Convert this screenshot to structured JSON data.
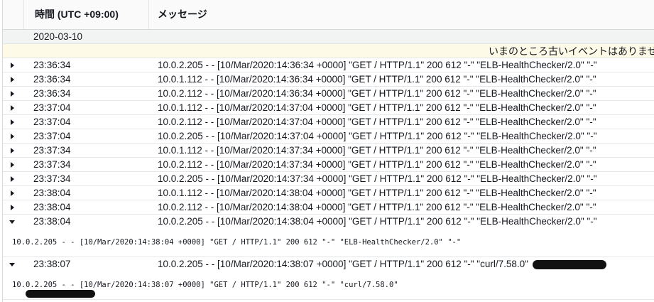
{
  "header": {
    "time_col": "時間 (UTC +09:00)",
    "message_col": "メッセージ"
  },
  "date_group": "2020-03-10",
  "notice": "いまのところ古いイベントはありませ",
  "rows": [
    {
      "time": "23:36:34",
      "message": "10.0.2.205 - - [10/Mar/2020:14:36:34 +0000] \"GET / HTTP/1.1\" 200 612 \"-\" \"ELB-HealthChecker/2.0\" \"-\"",
      "expanded": false
    },
    {
      "time": "23:36:34",
      "message": "10.0.1.112 - - [10/Mar/2020:14:36:34 +0000] \"GET / HTTP/1.1\" 200 612 \"-\" \"ELB-HealthChecker/2.0\" \"-\"",
      "expanded": false
    },
    {
      "time": "23:36:34",
      "message": "10.0.2.112 - - [10/Mar/2020:14:36:34 +0000] \"GET / HTTP/1.1\" 200 612 \"-\" \"ELB-HealthChecker/2.0\" \"-\"",
      "expanded": false
    },
    {
      "time": "23:37:04",
      "message": "10.0.1.112 - - [10/Mar/2020:14:37:04 +0000] \"GET / HTTP/1.1\" 200 612 \"-\" \"ELB-HealthChecker/2.0\" \"-\"",
      "expanded": false
    },
    {
      "time": "23:37:04",
      "message": "10.0.2.112 - - [10/Mar/2020:14:37:04 +0000] \"GET / HTTP/1.1\" 200 612 \"-\" \"ELB-HealthChecker/2.0\" \"-\"",
      "expanded": false
    },
    {
      "time": "23:37:04",
      "message": "10.0.2.205 - - [10/Mar/2020:14:37:04 +0000] \"GET / HTTP/1.1\" 200 612 \"-\" \"ELB-HealthChecker/2.0\" \"-\"",
      "expanded": false
    },
    {
      "time": "23:37:34",
      "message": "10.0.1.112 - - [10/Mar/2020:14:37:34 +0000] \"GET / HTTP/1.1\" 200 612 \"-\" \"ELB-HealthChecker/2.0\" \"-\"",
      "expanded": false
    },
    {
      "time": "23:37:34",
      "message": "10.0.2.112 - - [10/Mar/2020:14:37:34 +0000] \"GET / HTTP/1.1\" 200 612 \"-\" \"ELB-HealthChecker/2.0\" \"-\"",
      "expanded": false
    },
    {
      "time": "23:37:34",
      "message": "10.0.2.205 - - [10/Mar/2020:14:37:34 +0000] \"GET / HTTP/1.1\" 200 612 \"-\" \"ELB-HealthChecker/2.0\" \"-\"",
      "expanded": false
    },
    {
      "time": "23:38:04",
      "message": "10.0.1.112 - - [10/Mar/2020:14:38:04 +0000] \"GET / HTTP/1.1\" 200 612 \"-\" \"ELB-HealthChecker/2.0\" \"-\"",
      "expanded": false
    },
    {
      "time": "23:38:04",
      "message": "10.0.2.112 - - [10/Mar/2020:14:38:04 +0000] \"GET / HTTP/1.1\" 200 612 \"-\" \"ELB-HealthChecker/2.0\" \"-\"",
      "expanded": false
    },
    {
      "time": "23:38:04",
      "message": "10.0.2.205 - - [10/Mar/2020:14:38:04 +0000] \"GET / HTTP/1.1\" 200 612 \"-\" \"ELB-HealthChecker/2.0\" \"-\"",
      "expanded": true,
      "detail": "10.0.2.205 - - [10/Mar/2020:14:38:04 +0000] \"GET / HTTP/1.1\" 200 612 \"-\" \"ELB-HealthChecker/2.0\" \"-\""
    },
    {
      "time": "23:38:07",
      "message": "10.0.2.205 - - [10/Mar/2020:14:38:07 +0000] \"GET / HTTP/1.1\" 200 612 \"-\" \"curl/7.58.0\"",
      "expanded": true,
      "redacted": true,
      "detail": "10.0.2.205 - - [10/Mar/2020:14:38:07 +0000] \"GET / HTTP/1.1\" 200 612 \"-\" \"curl/7.58.0\""
    }
  ]
}
